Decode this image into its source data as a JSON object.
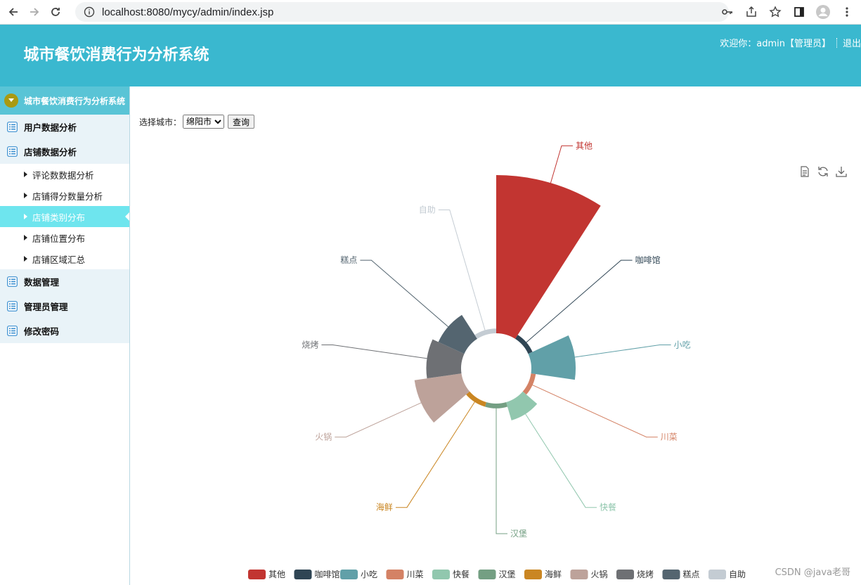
{
  "browser": {
    "url": "localhost:8080/mycy/admin/index.jsp"
  },
  "header": {
    "title": "城市餐饮消费行为分析系统",
    "welcome": "欢迎你：admin【管理员】",
    "logout": "退出"
  },
  "sidebar": {
    "root_label": "城市餐饮消费行为分析系统",
    "menu_user": "用户数据分析",
    "menu_shop": "店铺数据分析",
    "sub_items": [
      "评论数数据分析",
      "店铺得分数量分析",
      "店铺类别分布",
      "店铺位置分布",
      "店铺区域汇总"
    ],
    "active_index": 2,
    "menu_data": "数据管理",
    "menu_admin": "管理员管理",
    "menu_password": "修改密码"
  },
  "filter": {
    "label": "选择城市：",
    "selected_city": "绵阳市",
    "query_button": "查询"
  },
  "watermark": "CSDN @java老哥",
  "colors": {
    "header": "#3ab8cf",
    "sidebar_active": "#6ee5ee"
  },
  "chart_data": {
    "type": "rose-pie",
    "categories": [
      "其他",
      "咖啡馆",
      "小吃",
      "川菜",
      "快餐",
      "汉堡",
      "海鲜",
      "火锅",
      "烧烤",
      "糕点",
      "自助"
    ],
    "values": [
      100,
      3,
      28,
      3,
      12,
      3,
      3,
      30,
      22,
      18,
      3
    ],
    "colors": [
      "#c23531",
      "#2f4554",
      "#61a0a8",
      "#d48265",
      "#91c7ae",
      "#749f83",
      "#ca8622",
      "#bda29a",
      "#6e7074",
      "#546570",
      "#c4ccd3"
    ],
    "legend_position": "bottom"
  }
}
